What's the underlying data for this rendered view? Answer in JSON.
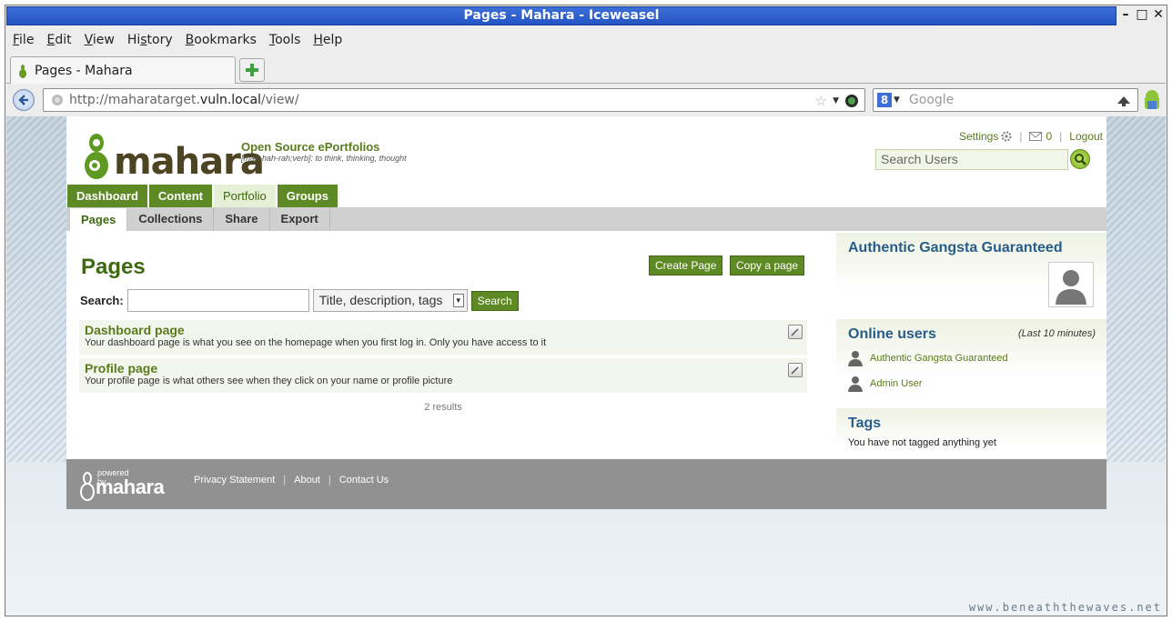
{
  "window": {
    "title": "Pages - Mahara - Iceweasel",
    "controls": [
      "–",
      "□",
      "✕"
    ]
  },
  "menu": [
    {
      "underline": "F",
      "rest": "ile"
    },
    {
      "underline": "E",
      "rest": "dit"
    },
    {
      "underline": "V",
      "rest": "iew"
    },
    {
      "prefix": "Hi",
      "underline": "s",
      "rest": "tory"
    },
    {
      "underline": "B",
      "rest": "ookmarks"
    },
    {
      "underline": "T",
      "rest": "ools"
    },
    {
      "underline": "H",
      "rest": "elp"
    }
  ],
  "tab": {
    "label": "Pages - Mahara"
  },
  "urlbar": {
    "scheme": "http://maharatarget.",
    "host": "vuln.local",
    "path": "/view/"
  },
  "websearch": {
    "placeholder": "Google",
    "engine_letter": "8"
  },
  "site": {
    "logo_text": "mahara",
    "tagline": "Open Source ePortfolios",
    "tagline_sub": "[mah-hah-rah;verb]: to think, thinking, thought",
    "settings": "Settings",
    "inbox_count": "0",
    "logout": "Logout",
    "user_search_placeholder": "Search Users"
  },
  "mainnav": [
    "Dashboard",
    "Content",
    "Portfolio",
    "Groups"
  ],
  "mainnav_active": "Portfolio",
  "subnav": [
    "Pages",
    "Collections",
    "Share",
    "Export"
  ],
  "subnav_active": "Pages",
  "main": {
    "title": "Pages",
    "create_page": "Create Page",
    "copy_page": "Copy a page",
    "search_label": "Search:",
    "search_value": "",
    "search_scope": "Title, description, tags",
    "search_button": "Search",
    "results": [
      {
        "title": "Dashboard page",
        "description": "Your dashboard page is what you see on the homepage when you first log in. Only you have access to it"
      },
      {
        "title": "Profile page",
        "description": "Your profile page is what others see when they click on your name or profile picture"
      }
    ],
    "result_count": "2 results"
  },
  "sidebar": {
    "profile_name": "Authentic Gangsta Guaranteed",
    "online_title": "Online users",
    "online_hint": "(Last 10 minutes)",
    "online_users": [
      "Authentic Gangsta Guaranteed",
      "Admin User"
    ],
    "tags_title": "Tags",
    "tags_empty": "You have not tagged anything yet"
  },
  "footer": {
    "powered_by": "powered by",
    "logo_text": "mahara",
    "links": [
      "Privacy Statement",
      "About",
      "Contact Us"
    ]
  },
  "watermark": "www.beneaththewaves.net",
  "colors": {
    "accent_green": "#5e8a26",
    "link_green": "#5a7a1c",
    "heading_blue": "#275d8a",
    "titlebar_blue": "#2454c3"
  }
}
